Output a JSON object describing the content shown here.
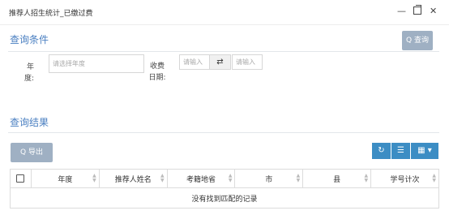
{
  "window": {
    "title": "推荐人招生统计_已缴过费",
    "min_glyph": "—",
    "close_glyph": "✕"
  },
  "query": {
    "section_title": "查询条件",
    "query_button": "Q 查询",
    "year_label": "年度:",
    "year_placeholder": "请选择年度",
    "fee_date_label": "收费日期:",
    "date_from_placeholder": "请输入",
    "swap_glyph": "⇄",
    "date_to_placeholder": "请输入"
  },
  "results": {
    "section_title": "查询结果",
    "export_button": "Q 导出",
    "toolbar": {
      "refresh_glyph": "↻",
      "list_glyph": "☰",
      "columns_glyph": "▦ ▾"
    },
    "columns": [
      "年度",
      "推荐人姓名",
      "考籍地省",
      "市",
      "县",
      "学号计次"
    ],
    "empty_message": "没有找到匹配的记录"
  },
  "colors": {
    "accent": "#4a7fc1",
    "button_gray": "#9fb0c3",
    "toolbar_blue": "#3c8dc4"
  }
}
